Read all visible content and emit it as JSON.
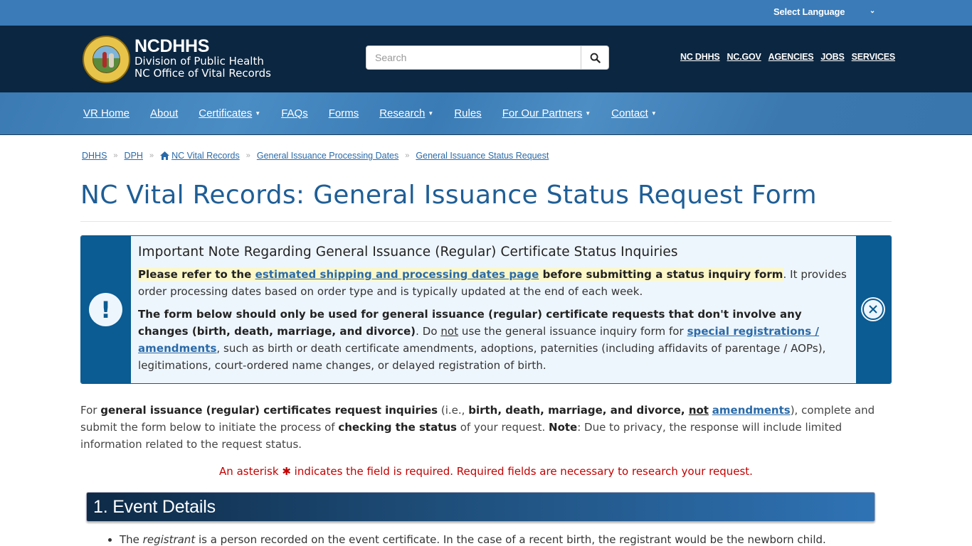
{
  "top_bar": {
    "language_label": "Select Language"
  },
  "header": {
    "brand_title": "NCDHHS",
    "brand_line1": "Division of Public Health",
    "brand_line2": "NC Office of Vital Records",
    "search_placeholder": "Search",
    "search_value": "",
    "util_links": [
      "NC DHHS",
      "NC.GOV",
      "AGENCIES",
      "JOBS",
      "SERVICES"
    ]
  },
  "nav": {
    "items": [
      {
        "label": "VR Home",
        "dropdown": false
      },
      {
        "label": "About",
        "dropdown": false
      },
      {
        "label": "Certificates",
        "dropdown": true
      },
      {
        "label": "FAQs",
        "dropdown": false
      },
      {
        "label": "Forms",
        "dropdown": false
      },
      {
        "label": "Research",
        "dropdown": true
      },
      {
        "label": "Rules",
        "dropdown": false
      },
      {
        "label": "For Our Partners",
        "dropdown": true
      },
      {
        "label": "Contact",
        "dropdown": true
      }
    ]
  },
  "breadcrumb": [
    "DHHS",
    "DPH",
    "NC Vital Records",
    "General Issuance Processing Dates",
    "General Issuance Status Request"
  ],
  "page_title": "NC Vital Records: General Issuance Status Request Form",
  "alert": {
    "title": "Important Note Regarding General Issuance (Regular) Certificate Status Inquiries",
    "p1_pre": "Please refer to the ",
    "p1_link": "estimated shipping and processing dates page",
    "p1_bold_post": " before submitting a status inquiry form",
    "p1_rest": ". It provides order processing dates based on order type and is typically updated at the end of each week.",
    "p2_bold": "The form below should only be used for general issuance (regular) certificate requests that don't involve any changes (birth, death, marriage, and divorce)",
    "p2_a": ". Do ",
    "p2_not": "not",
    "p2_b": " use the general issuance inquiry form for ",
    "p2_link": "special registrations / amendments",
    "p2_c": ", such as birth or death certificate amendments, adoptions, paternities (including affidavits of parentage / AOPs), legitimations, court-ordered name changes, or delayed registration of birth."
  },
  "intro": {
    "a": "For ",
    "b_bold": "general issuance (regular) certificates request inquiries",
    "c": " (i.e., ",
    "d_bold": "birth, death, marriage, and divorce",
    "e": ", ",
    "f_not": "not",
    "g": " ",
    "h_link": "amendments",
    "i": "), complete and submit the form below to initiate the process of ",
    "j_bold": "checking the status",
    "k": " of your request. ",
    "l_bold": "Note",
    "m": ": Due to privacy, the response will include limited information related to the request status."
  },
  "required_note": {
    "pre": "An asterisk ",
    "asterisk": "✱",
    "post": " indicates the field is required. Required fields are necessary to research your request."
  },
  "section1": {
    "title": "1. Event Details",
    "bullet_pre": "The ",
    "bullet_em": "registrant",
    "bullet_post": " is a person recorded on the event certificate. In the case of a recent birth, the registrant would be the newborn child."
  },
  "colors": {
    "top_bar": "#3a7bb8",
    "header": "#0b2640",
    "title": "#1f5e96",
    "alert_accent": "#0a5c92",
    "alert_bg": "#eef6fd",
    "required": "#c40000",
    "link": "#2a6aa8"
  }
}
